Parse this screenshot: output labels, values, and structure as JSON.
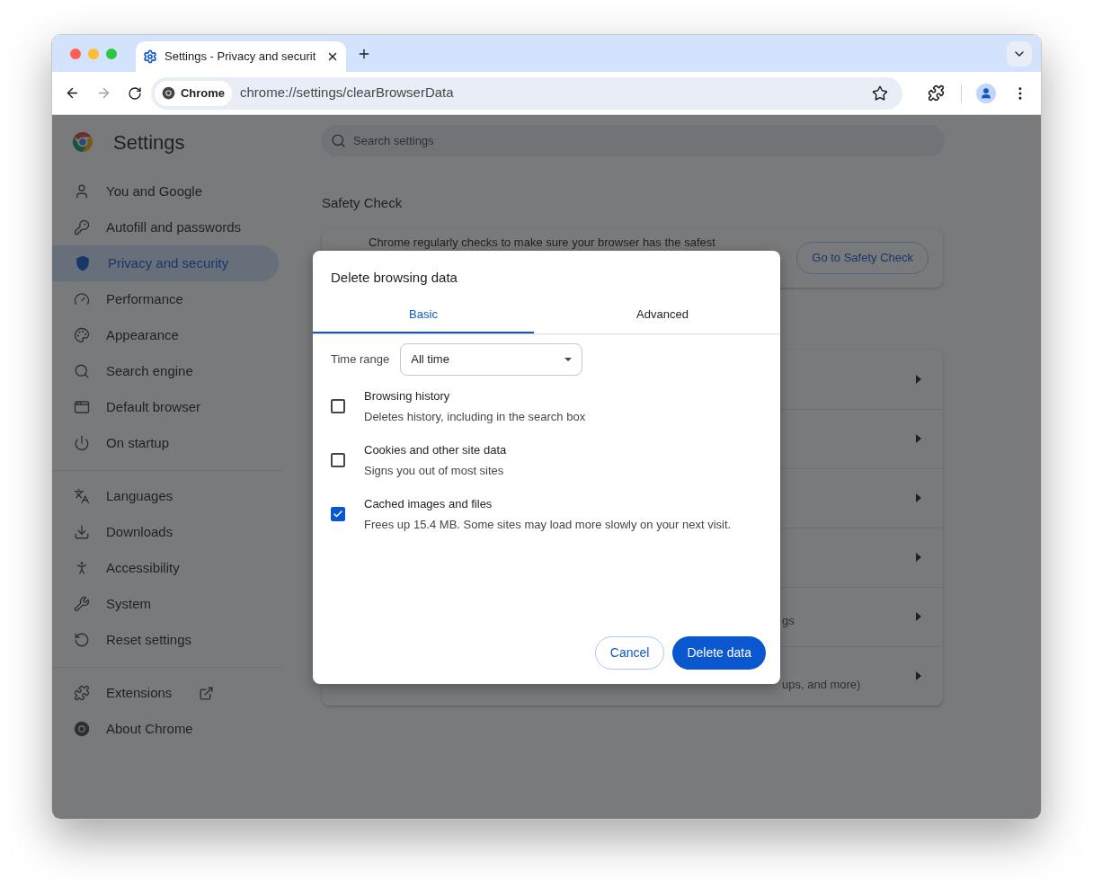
{
  "browser": {
    "tab_title": "Settings - Privacy and securit",
    "omnibox_chip": "Chrome",
    "url": "chrome://settings/clearBrowserData"
  },
  "settings": {
    "title": "Settings",
    "search": {
      "placeholder": "Search settings"
    },
    "sidebar": {
      "groups": [
        [
          {
            "label": "You and Google",
            "selected": false
          },
          {
            "label": "Autofill and passwords",
            "selected": false
          },
          {
            "label": "Privacy and security",
            "selected": true
          },
          {
            "label": "Performance",
            "selected": false
          },
          {
            "label": "Appearance",
            "selected": false
          },
          {
            "label": "Search engine",
            "selected": false
          },
          {
            "label": "Default browser",
            "selected": false
          },
          {
            "label": "On startup",
            "selected": false
          }
        ],
        [
          {
            "label": "Languages",
            "selected": false
          },
          {
            "label": "Downloads",
            "selected": false
          },
          {
            "label": "Accessibility",
            "selected": false
          },
          {
            "label": "System",
            "selected": false
          },
          {
            "label": "Reset settings",
            "selected": false
          }
        ],
        [
          {
            "label": "Extensions",
            "selected": false,
            "external": true
          },
          {
            "label": "About Chrome",
            "selected": false
          }
        ]
      ]
    },
    "safety_check": {
      "heading": "Safety Check",
      "text": "Chrome regularly checks to make sure your browser has the safest",
      "button": "Go to Safety Check"
    },
    "list_rows": [
      {
        "expandable": true
      },
      {
        "expandable": true
      },
      {
        "expandable": true
      },
      {
        "expandable": true
      },
      {
        "expandable": true,
        "text": "gs"
      },
      {
        "expandable": true,
        "text": "ups, and more)"
      }
    ]
  },
  "dialog": {
    "title": "Delete browsing data",
    "tabs": [
      {
        "label": "Basic",
        "selected": true
      },
      {
        "label": "Advanced",
        "selected": false
      }
    ],
    "time_range": {
      "label": "Time range",
      "value": "All time"
    },
    "options": [
      {
        "title": "Browsing history",
        "description": "Deletes history, including in the search box",
        "checked": false
      },
      {
        "title": "Cookies and other site data",
        "description": "Signs you out of most sites",
        "checked": false
      },
      {
        "title": "Cached images and files",
        "description": "Frees up 15.4 MB. Some sites may load more slowly on your next visit.",
        "checked": true
      }
    ],
    "buttons": [
      {
        "label": "Cancel",
        "kind": "secondary"
      },
      {
        "label": "Delete data",
        "kind": "primary"
      }
    ]
  }
}
